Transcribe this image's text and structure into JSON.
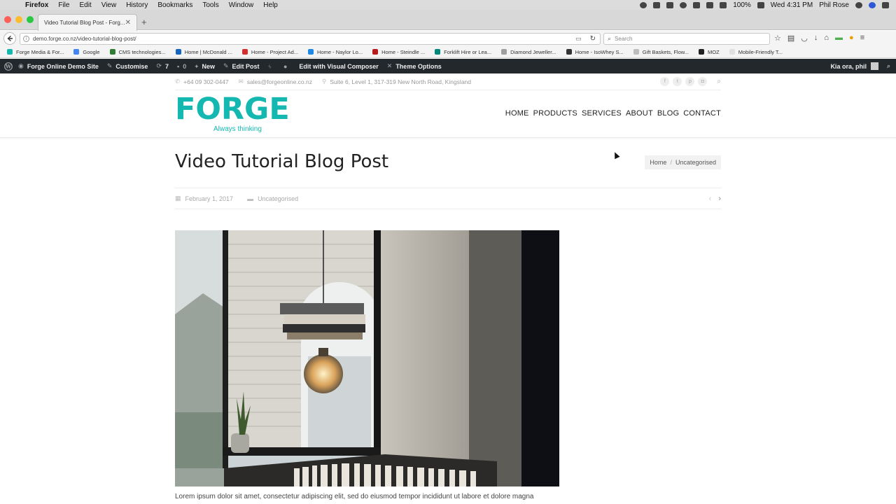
{
  "menubar": {
    "app": "Firefox",
    "items": [
      "File",
      "Edit",
      "View",
      "History",
      "Bookmarks",
      "Tools",
      "Window",
      "Help"
    ],
    "battery": "100%",
    "clock": "Wed 4:31 PM",
    "user": "Phil Rose"
  },
  "browser": {
    "tab_title": "Video Tutorial Blog Post - Forg...",
    "url": "demo.forge.co.nz/video-tutorial-blog-post/",
    "search_placeholder": "Search",
    "bookmarks": [
      {
        "label": "Forge Media & For...",
        "color": "#14b8b0"
      },
      {
        "label": "Google",
        "color": "#4285f4"
      },
      {
        "label": "CMS technologies...",
        "color": "#2e7d32"
      },
      {
        "label": "Home | McDonald ...",
        "color": "#1565c0"
      },
      {
        "label": "Home - Project Ad...",
        "color": "#d32f2f"
      },
      {
        "label": "Home - Naylor Lo...",
        "color": "#1e88e5"
      },
      {
        "label": "Home - Steindle ...",
        "color": "#b71c1c"
      },
      {
        "label": "Forklift Hire or Lea...",
        "color": "#00897b"
      },
      {
        "label": "Diamond Jeweller...",
        "color": "#9e9e9e"
      },
      {
        "label": "Home - IsoWhey S...",
        "color": "#333333"
      },
      {
        "label": "Gift Baskets, Flow...",
        "color": "#bdbdbd"
      },
      {
        "label": "MOZ",
        "color": "#222222"
      },
      {
        "label": "Mobile-Friendly T...",
        "color": "#e0e0e0"
      }
    ]
  },
  "adminbar": {
    "site_name": "Forge Online Demo Site",
    "customise": "Customise",
    "updates": "7",
    "comments": "0",
    "new": "New",
    "edit_post": "Edit Post",
    "visual_composer": "Edit with Visual Composer",
    "theme_options": "Theme Options",
    "greeting": "Kia ora, phil"
  },
  "site": {
    "phone": "+64 09 302-0447",
    "email": "sales@forgeonline.co.nz",
    "address": "Suite 6, Level 1, 317-319 New North Road, Kingsland",
    "logo_word": "FORGE",
    "logo_tagline": "Always thinking",
    "brand_color": "#14b8b0",
    "nav": [
      "HOME",
      "PRODUCTS",
      "SERVICES",
      "ABOUT",
      "BLOG",
      "CONTACT"
    ]
  },
  "post": {
    "title": "Video Tutorial Blog Post",
    "breadcrumb": [
      "Home",
      "Uncategorised"
    ],
    "date": "February 1, 2017",
    "category": "Uncategorised",
    "excerpt": "Lorem ipsum dolor sit amet, consectetur adipiscing elit, sed do eiusmod tempor incididunt ut labore et dolore magna"
  }
}
